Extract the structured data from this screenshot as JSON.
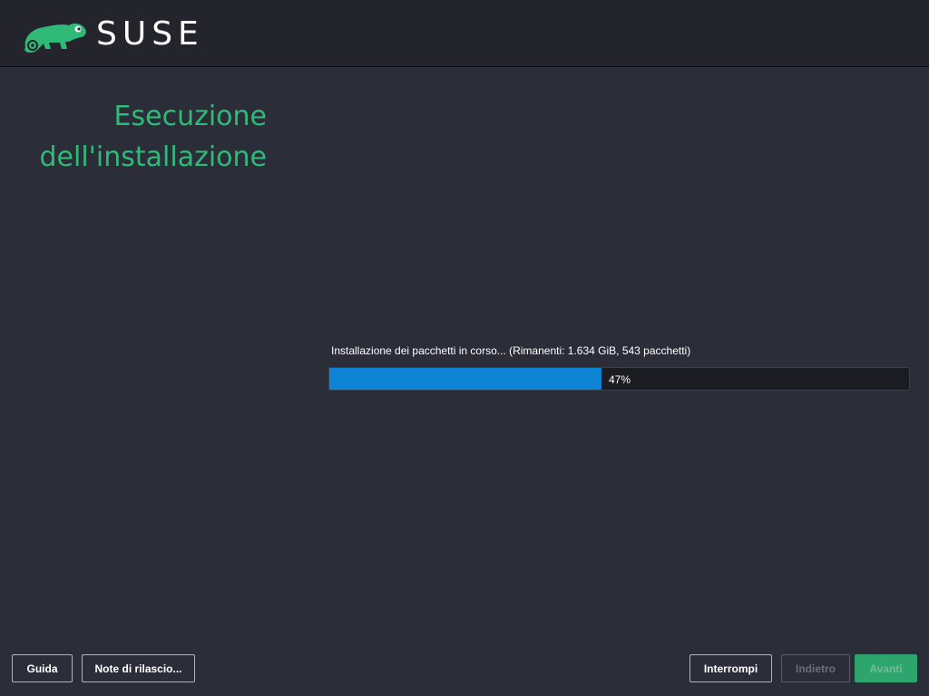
{
  "brand": {
    "logo_text": "SUSE",
    "icon": "suse-chameleon-icon",
    "accent_color": "#30ba78"
  },
  "page": {
    "title_line1": "Esecuzione",
    "title_line2": "dell'installazione"
  },
  "progress": {
    "label": "Installazione dei pacchetti in corso... (Rimanenti: 1.634 GiB, 543 pacchetti)",
    "percent_text": "47%",
    "percent_value": 47,
    "fill_color": "#0c84d3"
  },
  "footer": {
    "help_label": "Guida",
    "release_notes_label": "Note di rilascio...",
    "abort_label": "Interrompi",
    "back_label": "Indietro",
    "next_label": "Avanti"
  }
}
